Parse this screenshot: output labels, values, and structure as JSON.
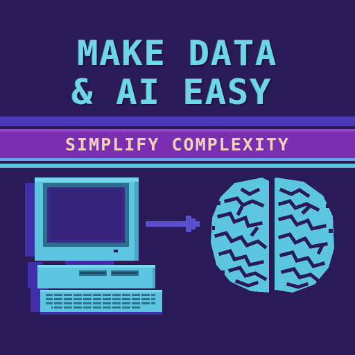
{
  "poster": {
    "headline_line1": "MAKE DATA",
    "headline_line2": "& AI EASY",
    "subheadline": "SIMPLIFY COMPLEXITY"
  },
  "icons": {
    "computer": "retro-computer-icon",
    "arrow": "arrow-right-icon",
    "brain": "brain-icon"
  },
  "colors": {
    "background": "#2a1a55",
    "headline": "#6fd6e6",
    "band": "#7a2fb0",
    "subheadline": "#f2d2b6",
    "accent": "#5cc6e0",
    "arrow": "#5a4fd0"
  }
}
